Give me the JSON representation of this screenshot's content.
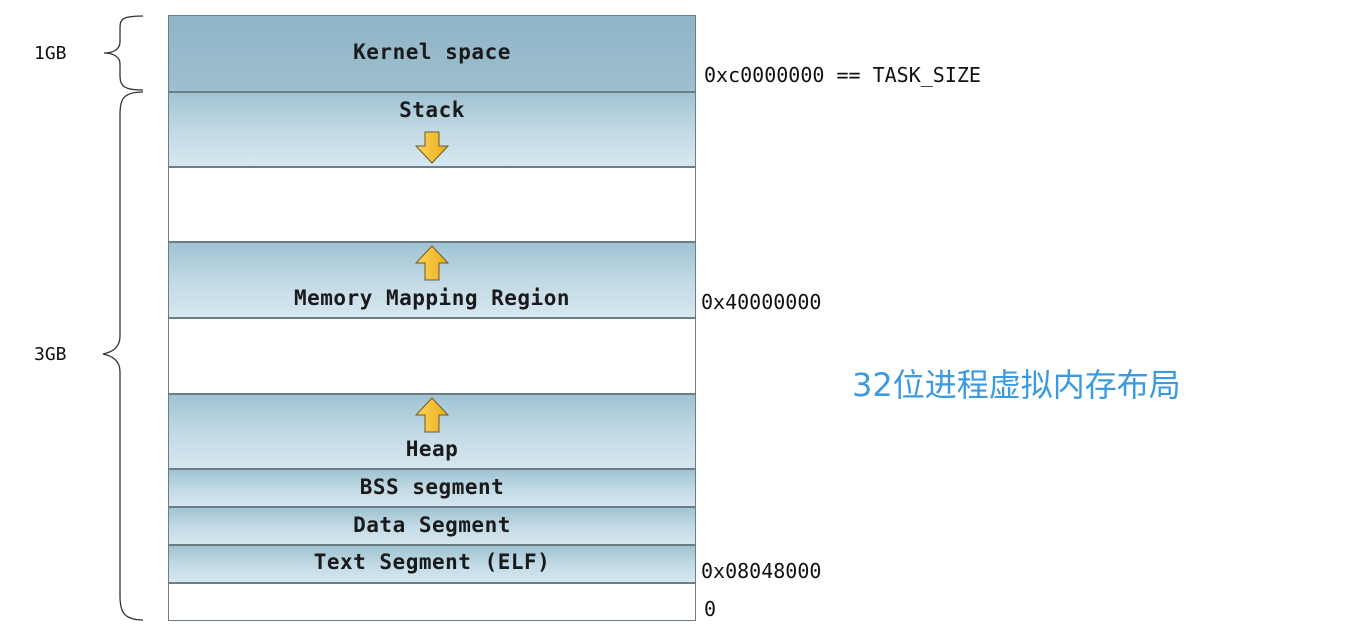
{
  "title": "32位进程虚拟内存布局",
  "segments": {
    "kernel": "Kernel space",
    "stack": "Stack",
    "mmap": "Memory Mapping Region",
    "heap": "Heap",
    "bss": "BSS segment",
    "data": "Data Segment",
    "text": "Text Segment (ELF)"
  },
  "addresses": {
    "task_size": "0xc0000000 == TASK_SIZE",
    "mmap_base": "0x40000000",
    "text_base": "0x08048000",
    "zero": "0"
  },
  "sizes": {
    "kernel": "1GB",
    "user": "3GB"
  },
  "colors": {
    "segment_fill": "#a0c3d3",
    "arrow_fill": "#f7c227",
    "caption": "#3b9ae0"
  }
}
